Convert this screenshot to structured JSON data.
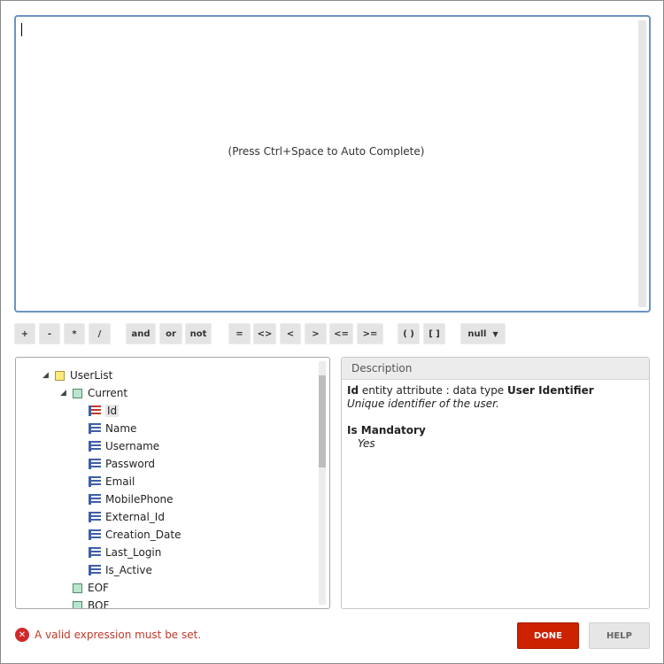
{
  "editor": {
    "placeholder": "(Press Ctrl+Space to Auto Complete)"
  },
  "toolbar": {
    "operators": [
      "+",
      "-",
      "*",
      "/",
      "and",
      "or",
      "not",
      "=",
      "<>",
      "<",
      ">",
      "<=",
      ">=",
      "( )",
      "[ ]",
      "null"
    ]
  },
  "tree": {
    "root": "UserList",
    "current": "Current",
    "attributes": [
      "Id",
      "Name",
      "Username",
      "Password",
      "Email",
      "MobilePhone",
      "External_Id",
      "Creation_Date",
      "Last_Login",
      "Is_Active"
    ],
    "selected": "Id",
    "eof": "EOF",
    "bof": "BOF"
  },
  "description": {
    "title": "Description",
    "attr_name": "Id",
    "attr_text": " entity attribute : data type ",
    "data_type": "User Identifier",
    "summary": "Unique identifier of the user.",
    "mandatory_label": "Is Mandatory",
    "mandatory_value": "Yes"
  },
  "footer": {
    "error_message": "A valid expression must be set.",
    "done_label": "DONE",
    "help_label": "HELP"
  },
  "colors": {
    "accent": "#cc2200",
    "editor_border": "#6b93c3",
    "error": "#c0392b"
  }
}
